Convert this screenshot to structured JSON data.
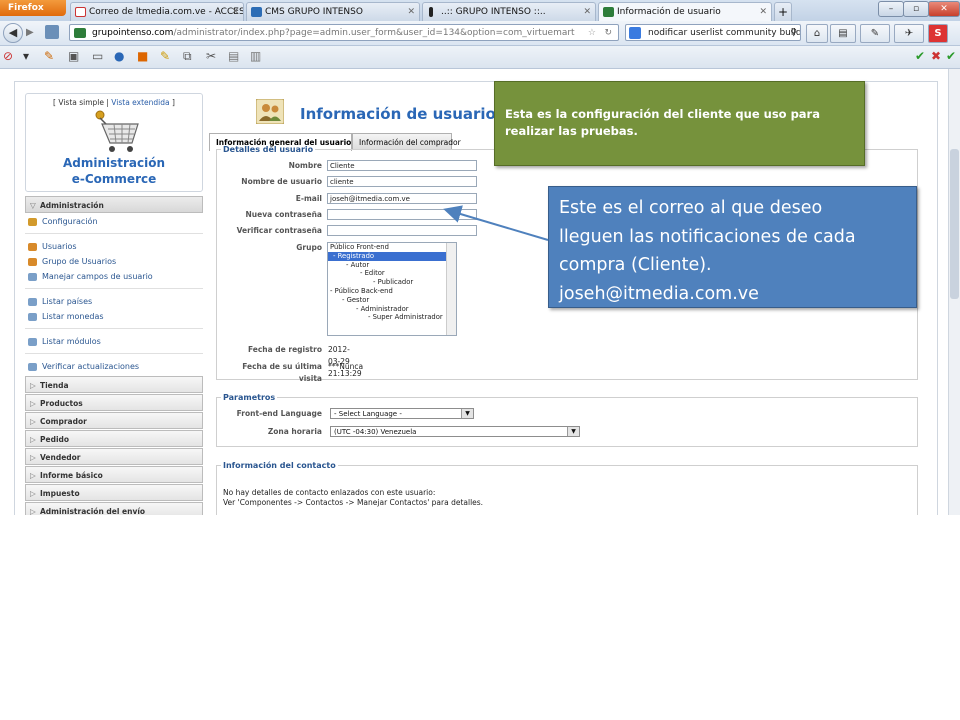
{
  "browser": {
    "app_button": "Firefox",
    "tabs": [
      {
        "title": "Correo de ltmedia.com.ve - ACCESO..."
      },
      {
        "title": "CMS GRUPO INTENSO"
      },
      {
        "title": "..:: GRUPO INTENSO ::.."
      },
      {
        "title": "Información de usuario"
      }
    ],
    "url_host": "grupointenso.com",
    "url_path": "/administrator/index.php?page=admin.user_form&user_id=134&option=com_virtuemart",
    "search_text": "nodificar userlist community builder"
  },
  "sidebar": {
    "view_simple": "[ Vista simple |",
    "view_extended": "Vista extendida",
    "view_close": "]",
    "title_line1": "Administración",
    "title_line2": "e-Commerce",
    "active_section": "Administración",
    "items": [
      {
        "label": "Configuración"
      },
      {
        "label": "Usuarios"
      },
      {
        "label": "Grupo de Usuarios"
      },
      {
        "label": "Manejar campos de usuario"
      },
      {
        "label": "Listar países"
      },
      {
        "label": "Listar monedas"
      },
      {
        "label": "Listar módulos"
      },
      {
        "label": "Verificar actualizaciones"
      }
    ],
    "sections": [
      {
        "label": "Tienda"
      },
      {
        "label": "Productos"
      },
      {
        "label": "Comprador"
      },
      {
        "label": "Pedido"
      },
      {
        "label": "Vendedor"
      },
      {
        "label": "Informe básico"
      },
      {
        "label": "Impuesto"
      },
      {
        "label": "Administración del envío"
      }
    ]
  },
  "main": {
    "page_title": "Información de usuario",
    "tabs": [
      {
        "label": "Información general del usuario"
      },
      {
        "label": "Información del comprador"
      }
    ],
    "details": {
      "legend": "Detalles del usuario",
      "name_label": "Nombre",
      "name_value": "Cliente",
      "username_label": "Nombre de usuario",
      "username_value": "cliente",
      "email_label": "E-mail",
      "email_value": "joseh@itmedia.com.ve",
      "newpass_label": "Nueva contraseña",
      "verify_label": "Verificar contraseña",
      "group_label": "Grupo",
      "groups": [
        "Público Front-end",
        "- Registrado",
        "- Autor",
        "- Editor",
        "- Publicador",
        "- Público Back-end",
        "- Gestor",
        "- Administrador",
        "- Super Administrador"
      ],
      "selected_group": "- Registrado",
      "regdate_label": "Fecha de registro",
      "regdate_value": "2012-03-29 21:13:29",
      "lastvisit_label": "Fecha de su última visita",
      "lastvisit_value": "***Nunca"
    },
    "params": {
      "legend": "Parametros",
      "lang_label": "Front-end Language",
      "lang_value": "- Select Language -",
      "tz_label": "Zona horaria",
      "tz_value": "(UTC -04:30) Venezuela"
    },
    "contact": {
      "legend": "Información del contacto",
      "line1": "No hay detalles de contacto enlazados con este usuario:",
      "line2": "Ver 'Componentes -> Contactos -> Manejar Contactos' para detalles."
    }
  },
  "callouts": {
    "green": "Esta es la configuración del cliente que uso para realizar las pruebas.",
    "blue_lines": [
      "Este es el correo al que deseo",
      "lleguen las notificaciones de cada",
      "compra (Cliente).",
      "joseh@itmedia.com.ve"
    ]
  },
  "colors": {
    "green_callout": "#76923c",
    "blue_callout": "#4f81bd",
    "title_blue": "#2a67b6",
    "firefox_orange": "#e8781c"
  }
}
